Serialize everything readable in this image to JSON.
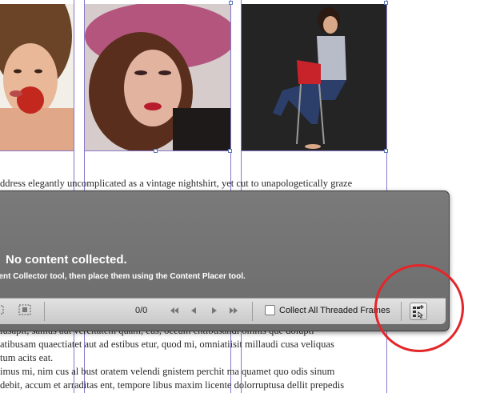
{
  "page": {
    "images": [
      {
        "name": "woman-eating-apple-photo"
      },
      {
        "name": "woman-pink-hat-photo"
      },
      {
        "name": "woman-on-red-chair-photo"
      }
    ],
    "top_text": [
      "ddress elegantly uncomplicated as a vintage nightshirt, yet cut to unapologetically graze"
    ],
    "bottom_text": [
      "iusapit, samus aut vercitatem quam, cus, occum entibusandi omnis que dolupti",
      "atibusam quaectiatet aut ad estibus etur, quod mi, omniatiisit millaudi cusa veliquas",
      "tum acits eat.",
      "imus mi, nim cus al bust oratem velendi gnistem perchit ma quamet quo odis sinum",
      "debit, accum et arraditas ent, tempore libus maxim licente dolorruptusa dellit prepedis"
    ]
  },
  "conveyor": {
    "empty_title": "No content collected.",
    "empty_hint": "ntent Collector tool, then place them using the Content Placer tool.",
    "toolbar": {
      "left_icons": [
        "place-mode-icon",
        "collect-mode-icon"
      ],
      "counter": "0/0",
      "nav_icons": [
        "first-icon",
        "previous-icon",
        "next-icon",
        "last-icon"
      ],
      "collect_all_label": "Collect All Threaded Frames",
      "collect_all_checked": false,
      "load_icon": "load-conveyor-icon"
    }
  },
  "colors": {
    "panel": "#6f6f6f",
    "toolbar": "#d6d6d6",
    "guide": "#8878c8",
    "callout": "#e3262a"
  }
}
